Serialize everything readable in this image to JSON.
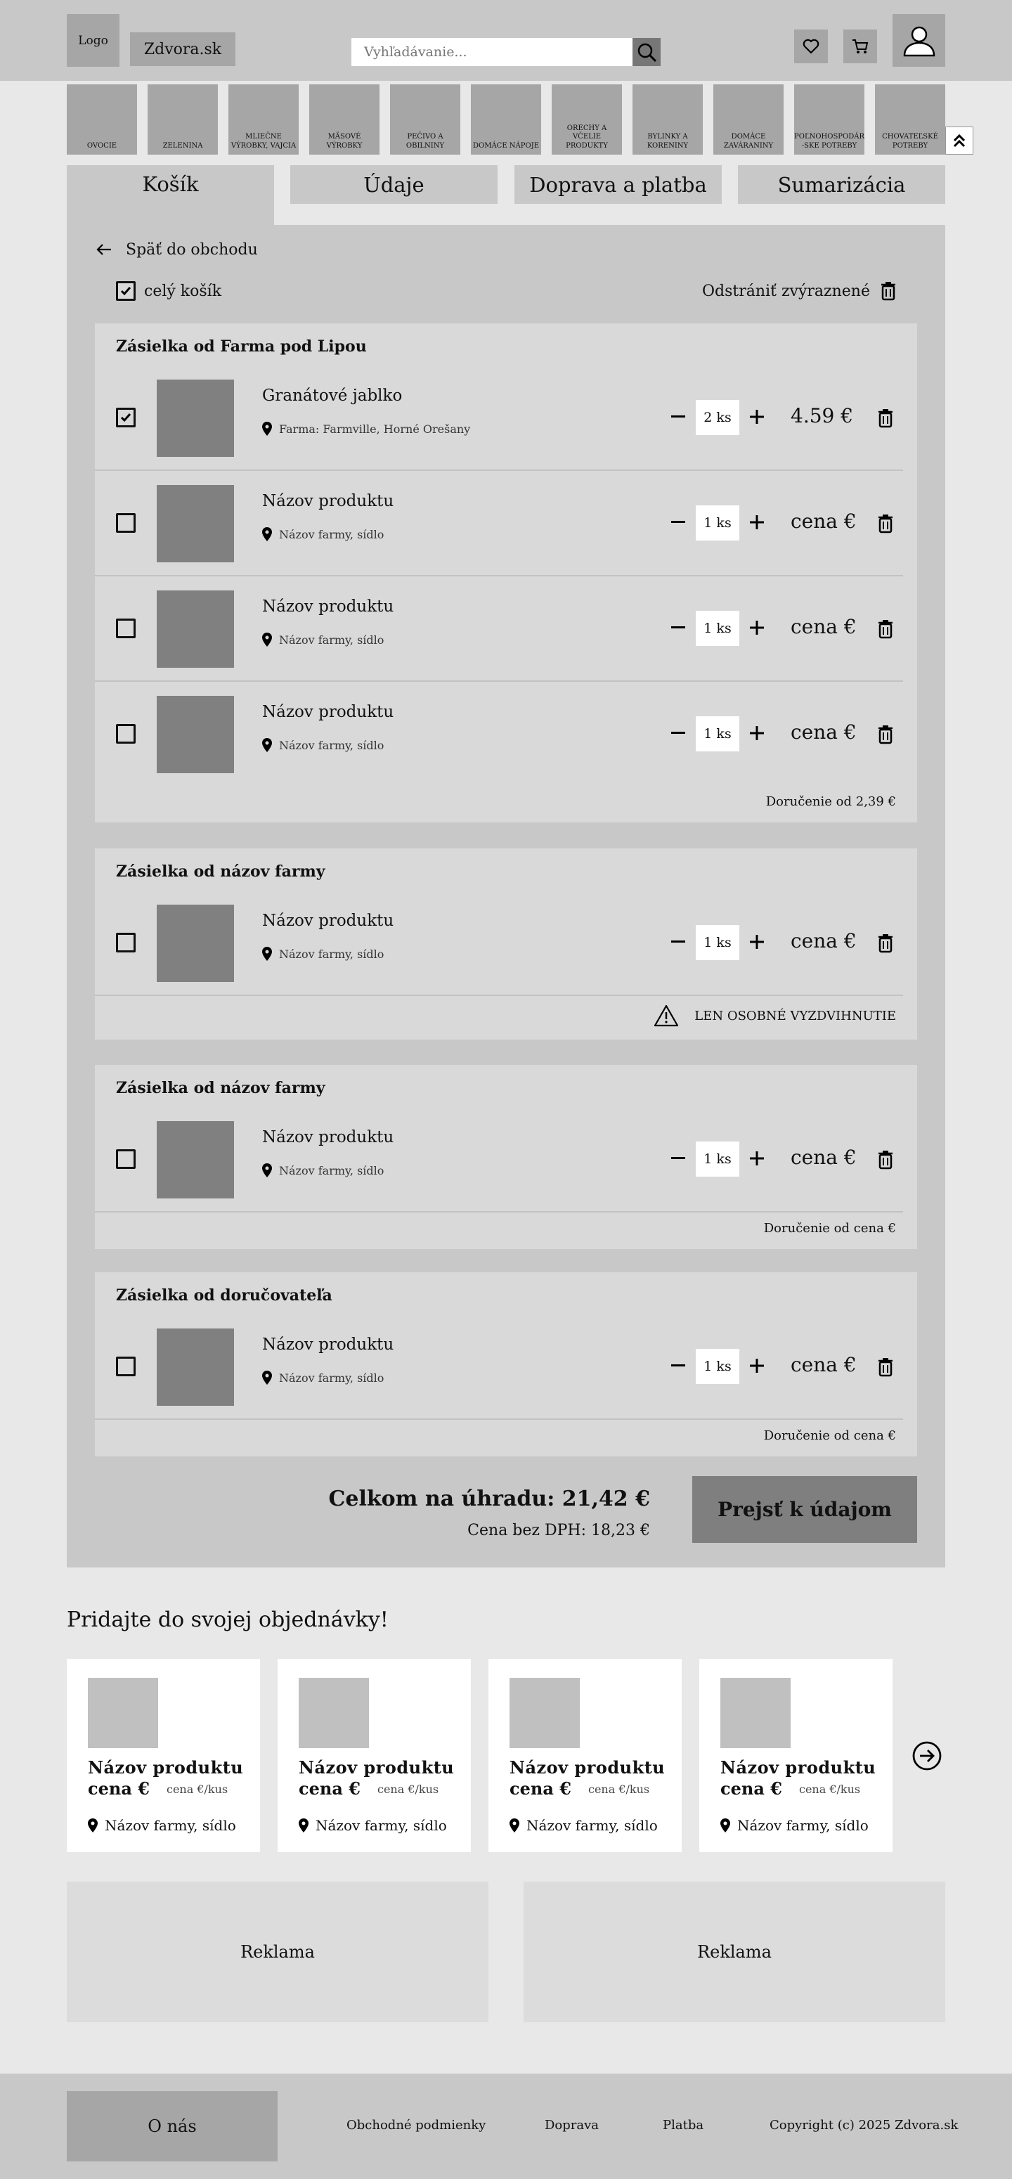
{
  "header": {
    "logo": "Logo",
    "site_name": "Zdvora.sk",
    "search_placeholder": "Vyhľadávanie..."
  },
  "categories": [
    [
      "OVOCIE"
    ],
    [
      "ZELENINA"
    ],
    [
      "MLIEČNE",
      "VÝROBKY, VAJCIA"
    ],
    [
      "MÄSOVÉ",
      "VÝROBKY"
    ],
    [
      "PEČIVO A",
      "OBILNINY"
    ],
    [
      "DOMÁCE NÁPOJE"
    ],
    [
      "ORECHY A VČELIE",
      "PRODUKTY"
    ],
    [
      "BYLINKY A",
      "KORENINY"
    ],
    [
      "DOMÁCE",
      "ZAVÁRANINY"
    ],
    [
      "POĽNOHOSPODÁR",
      "-SKE POTREBY"
    ],
    [
      "CHOVATEĽSKÉ",
      "POTREBY"
    ]
  ],
  "tabs": [
    "Košík",
    "Údaje",
    "Doprava a platba",
    "Sumarizácia"
  ],
  "cart": {
    "back": "Späť do obchodu",
    "select_all": "celý košík",
    "remove_selected": "Odstrániť zvýraznené",
    "shipments": [
      {
        "title": "Zásielka od Farma pod Lipou",
        "items": [
          {
            "name": "Granátové jablko",
            "farm": "Farma: Farmville, Horné Orešany",
            "qty": "2 ks",
            "price": "4.59 €",
            "checked": true
          },
          {
            "name": "Názov produktu",
            "farm": "Názov farmy, sídlo",
            "qty": "1 ks",
            "price": "cena €",
            "checked": false
          },
          {
            "name": "Názov produktu",
            "farm": "Názov farmy, sídlo",
            "qty": "1 ks",
            "price": "cena €",
            "checked": false
          },
          {
            "name": "Názov produktu",
            "farm": "Názov farmy, sídlo",
            "qty": "1 ks",
            "price": "cena €",
            "checked": false
          }
        ],
        "note": "Doručenie od 2,39 €"
      },
      {
        "title": "Zásielka od názov farmy",
        "items": [
          {
            "name": "Názov produktu",
            "farm": "Názov farmy, sídlo",
            "qty": "1 ks",
            "price": "cena €",
            "checked": false
          }
        ],
        "note": "LEN OSOBNÉ VYZDVIHNUTIE"
      },
      {
        "title": "Zásielka od názov farmy",
        "items": [
          {
            "name": "Názov produktu",
            "farm": "Názov farmy, sídlo",
            "qty": "1 ks",
            "price": "cena €",
            "checked": false
          }
        ],
        "note": "Doručenie od cena €"
      },
      {
        "title": "Zásielka od doručovateľa",
        "items": [
          {
            "name": "Názov produktu",
            "farm": "Názov farmy, sídlo",
            "qty": "1 ks",
            "price": "cena €",
            "checked": false
          }
        ],
        "note": "Doručenie od cena €"
      }
    ],
    "total": "Celkom na úhradu: 21,42 €",
    "total_no_vat": "Cena bez DPH: 18,23 €",
    "continue": "Prejsť k údajom"
  },
  "upsell": {
    "title": "Pridajte do svojej objednávky!",
    "products": [
      {
        "name": "Názov produktu",
        "price": "cena €",
        "unit": "cena €/kus",
        "farm": "Názov farmy, sídlo"
      },
      {
        "name": "Názov produktu",
        "price": "cena €",
        "unit": "cena €/kus",
        "farm": "Názov farmy, sídlo"
      },
      {
        "name": "Názov produktu",
        "price": "cena €",
        "unit": "cena €/kus",
        "farm": "Názov farmy, sídlo"
      },
      {
        "name": "Názov produktu",
        "price": "cena €",
        "unit": "cena €/kus",
        "farm": "Názov farmy, sídlo"
      }
    ]
  },
  "ads": [
    "Reklama",
    "Reklama"
  ],
  "footer": {
    "about": "O nás",
    "terms": "Obchodné podmienky",
    "shipping": "Doprava",
    "payment": "Platba",
    "copyright": "Copyright (c) 2025 Zdvora.sk"
  }
}
